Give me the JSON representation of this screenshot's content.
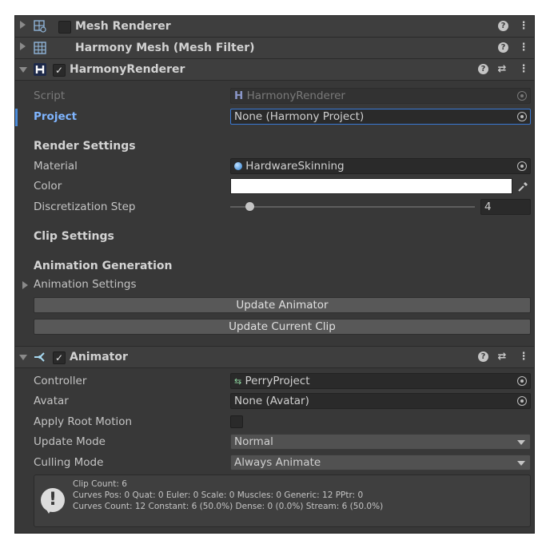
{
  "components": {
    "mesh_renderer": {
      "title": "Mesh Renderer",
      "help": "?",
      "menu": "⋮"
    },
    "mesh_filter": {
      "title": "Harmony Mesh (Mesh Filter)",
      "help": "?",
      "menu": "⋮"
    },
    "harmony_renderer": {
      "title": "HarmonyRenderer",
      "help": "?",
      "presets": "⇄",
      "menu": "⋮",
      "checked": "✓"
    },
    "animator": {
      "title": "Animator",
      "help": "?",
      "presets": "⇄",
      "menu": "⋮",
      "checked": "✓"
    }
  },
  "harmony": {
    "script_label": "Script",
    "script_value": "HarmonyRenderer",
    "project_label": "Project",
    "project_value": "None (Harmony Project)",
    "render_settings": "Render Settings",
    "material_label": "Material",
    "material_value": "HardwareSkinning",
    "color_label": "Color",
    "color_value": "#ffffff",
    "disc_label": "Discretization Step",
    "disc_value": "4",
    "disc_slider_fraction": 0.08,
    "clip_settings": "Clip Settings",
    "anim_generation": "Animation Generation",
    "anim_settings": "Animation Settings",
    "update_animator": "Update Animator",
    "update_clip": "Update Current Clip"
  },
  "animator": {
    "controller_label": "Controller",
    "controller_value": "PerryProject",
    "avatar_label": "Avatar",
    "avatar_value": "None (Avatar)",
    "root_motion_label": "Apply Root Motion",
    "update_mode_label": "Update Mode",
    "update_mode_value": "Normal",
    "culling_label": "Culling Mode",
    "culling_value": "Always Animate"
  },
  "info": {
    "line1": "Clip Count: 6",
    "line2": "Curves Pos: 0 Quat: 0 Euler: 0 Scale: 0 Muscles: 0 Generic: 12 PPtr: 0",
    "line3": "Curves Count: 12 Constant: 6 (50.0%) Dense: 0 (0.0%) Stream: 6 (50.0%)"
  },
  "colors": {
    "panel": "#383838",
    "header": "#3e3e3e",
    "accent": "#4a8ad8",
    "project_label": "#7fb5ff"
  }
}
